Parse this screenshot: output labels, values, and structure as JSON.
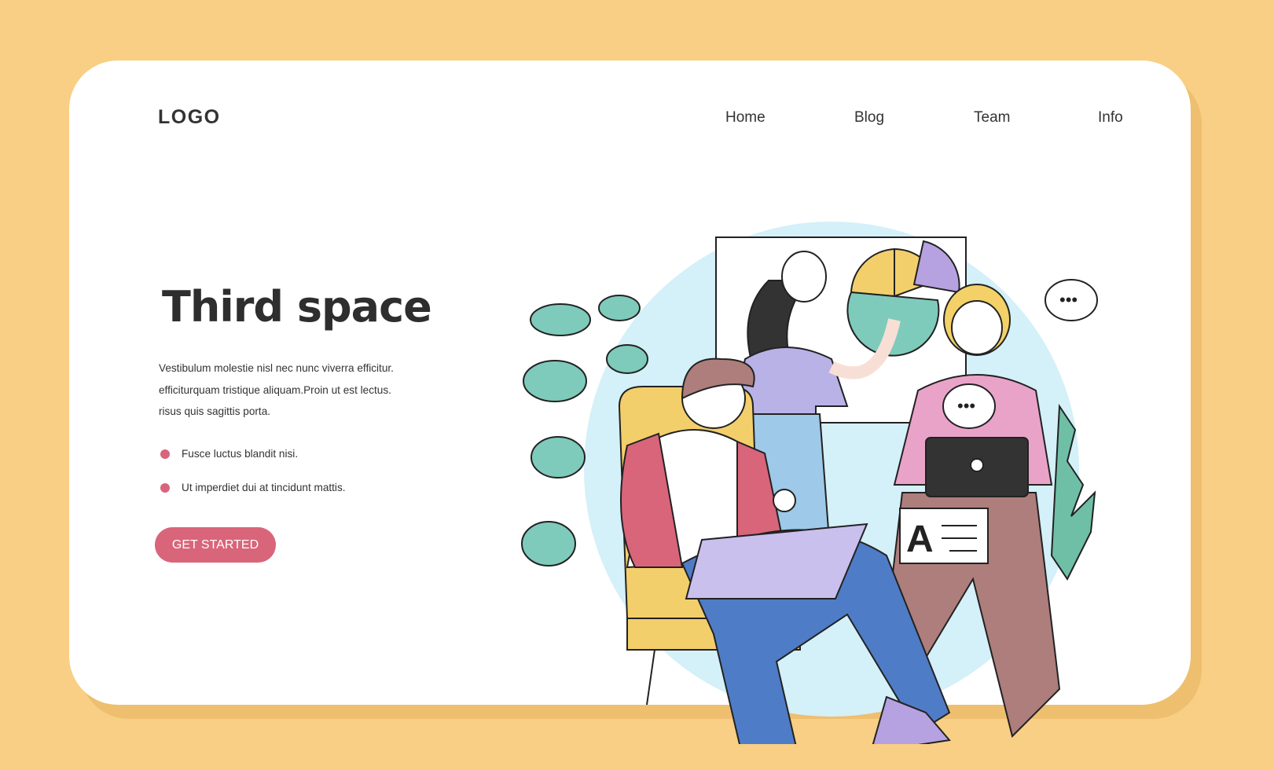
{
  "header": {
    "logo": "LOGO",
    "nav": [
      "Home",
      "Blog",
      "Team",
      "Info"
    ]
  },
  "hero": {
    "title": "Third space",
    "paragraph_lines": [
      "Vestibulum molestie nisl nec nunc viverra efficitur.",
      "efficiturquam tristique aliquam.Proin ut est lectus.",
      "risus quis sagittis porta."
    ],
    "bullets": [
      "Fusce luctus blandit nisi.",
      "Ut imperdiet dui at tincidunt mattis."
    ],
    "cta": "GET STARTED"
  },
  "illustration": {
    "caption_letter": "A"
  },
  "colors": {
    "background": "#f8cf84",
    "accent": "#d9657a",
    "circle": "#d4f0f8"
  }
}
